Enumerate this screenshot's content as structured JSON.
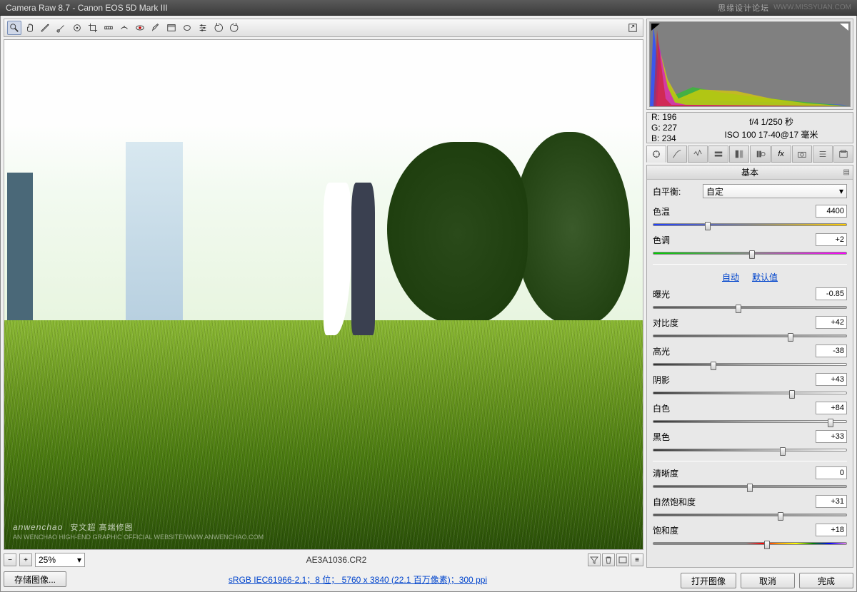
{
  "title": "Camera Raw 8.7  -  Canon EOS 5D Mark III",
  "watermark": "思缘设计论坛",
  "watermark_url": "WWW.MISSYUAN.COM",
  "toolbar_icons": [
    "zoom",
    "hand",
    "eyedropper-white",
    "eyedropper-color",
    "target",
    "crop",
    "straighten",
    "spot",
    "redeye",
    "brush",
    "grad-filter",
    "radial-filter",
    "prefs",
    "rotate-ccw",
    "rotate-cw"
  ],
  "zoom_level": "25%",
  "filename": "AE3A1036.CR2",
  "save_image": "存储图像...",
  "workflow_link": "sRGB IEC61966-2.1；8 位； 5760 x 3840 (22.1 百万像素)；300 ppi",
  "rgb": {
    "r_label": "R:",
    "r": "196",
    "g_label": "G:",
    "g": "227",
    "b_label": "B:",
    "b": "234"
  },
  "exif": {
    "line1": "f/4  1/250 秒",
    "line2": "ISO 100  17-40@17 毫米"
  },
  "panel_title": "基本",
  "wb": {
    "label": "白平衡:",
    "value": "自定"
  },
  "links": {
    "auto": "自动",
    "default": "默认值"
  },
  "sliders": {
    "temp": {
      "label": "色温",
      "value": "4400",
      "pos": 28,
      "grad": "gradient-temp"
    },
    "tint": {
      "label": "色调",
      "value": "+2",
      "pos": 51,
      "grad": "gradient-tint"
    },
    "exposure": {
      "label": "曝光",
      "value": "-0.85",
      "pos": 44,
      "grad": "gradient-gray"
    },
    "contrast": {
      "label": "对比度",
      "value": "+42",
      "pos": 71,
      "grad": "gradient-gray"
    },
    "highlight": {
      "label": "高光",
      "value": "-38",
      "pos": 31,
      "grad": "gradient-gray-centered"
    },
    "shadow": {
      "label": "阴影",
      "value": "+43",
      "pos": 72,
      "grad": "gradient-gray-centered"
    },
    "white": {
      "label": "白色",
      "value": "+84",
      "pos": 92,
      "grad": "gradient-gray-centered"
    },
    "black": {
      "label": "黑色",
      "value": "+33",
      "pos": 67,
      "grad": "gradient-gray-centered"
    },
    "clarity": {
      "label": "清晰度",
      "value": "0",
      "pos": 50,
      "grad": "gradient-gray"
    },
    "vibrance": {
      "label": "自然饱和度",
      "value": "+31",
      "pos": 66,
      "grad": "gradient-gray"
    },
    "sat": {
      "label": "饱和度",
      "value": "+18",
      "pos": 59,
      "grad": "gradient-sat"
    }
  },
  "buttons": {
    "open": "打开图像",
    "cancel": "取消",
    "done": "完成"
  },
  "img_watermark": "anwenchao",
  "img_watermark_sub": "AN WENCHAO HIGH-END GRAPHIC OFFICIAL WEBSITE/WWW.ANWENCHAO.COM",
  "img_watermark_cn": "安文超 高端修图"
}
